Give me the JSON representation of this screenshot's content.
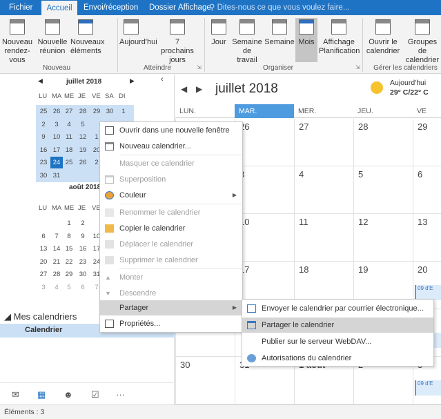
{
  "ribbon_tabs": [
    "Fichier",
    "Accueil",
    "Envoi/réception",
    "Dossier",
    "Affichage"
  ],
  "tell_me": "Dites-nous ce que vous voulez faire...",
  "ribbon": {
    "new_appointment": "Nouveau rendez-vous",
    "new_meeting": "Nouvelle réunion",
    "new_items": "Nouveaux éléments",
    "today": "Aujourd'hui",
    "next7": "7 prochains jours",
    "day": "Jour",
    "work_week": "Semaine de travail",
    "week": "Semaine",
    "month": "Mois",
    "schedule_view": "Affichage Planification",
    "open_calendar": "Ouvrir le calendrier",
    "calendar_groups": "Groupes de calendrier",
    "groups": [
      "Nouveau",
      "Atteindre",
      "Organiser",
      "Gérer les calendriers"
    ]
  },
  "nav": {
    "days_of_week": [
      "LU",
      "MA",
      "ME",
      "JE",
      "VE",
      "SA",
      "DI"
    ],
    "months": [
      {
        "title": "juillet 2018",
        "weeks": [
          [
            "25",
            "26",
            "27",
            "28",
            "29",
            "30",
            "1"
          ],
          [
            "2",
            "3",
            "4",
            "5",
            "",
            "",
            ""
          ],
          [
            "9",
            "10",
            "11",
            "12",
            "1",
            "",
            ""
          ],
          [
            "16",
            "17",
            "18",
            "19",
            "20",
            "",
            ""
          ],
          [
            "23",
            "24",
            "25",
            "26",
            "2",
            "",
            ""
          ],
          [
            "30",
            "31",
            "",
            "",
            "",
            "",
            ""
          ]
        ]
      },
      {
        "title": "août 2018",
        "weeks": [
          [
            "",
            "",
            "1",
            "2",
            "",
            "",
            ""
          ],
          [
            "6",
            "7",
            "8",
            "9",
            "10",
            "",
            ""
          ],
          [
            "13",
            "14",
            "15",
            "16",
            "17",
            "",
            ""
          ],
          [
            "20",
            "21",
            "22",
            "23",
            "24",
            "",
            ""
          ],
          [
            "27",
            "28",
            "29",
            "30",
            "31",
            "",
            ""
          ],
          [
            "3",
            "4",
            "5",
            "6",
            "7",
            "",
            ""
          ]
        ]
      }
    ],
    "my_calendars": "Mes calendriers",
    "calendar_item": "Calendrier"
  },
  "main": {
    "title": "juillet 2018",
    "weather_today": "Aujourd'hui",
    "weather_temp": "29° C/22° C",
    "columns": [
      "LUN.",
      "MAR.",
      "MER.",
      "JEU.",
      "VE"
    ],
    "rows": [
      [
        "",
        "26",
        "27",
        "28",
        "29"
      ],
      [
        "",
        "3",
        "4",
        "5",
        "6"
      ],
      [
        "",
        "10",
        "11",
        "12",
        "13"
      ],
      [
        "",
        "17",
        "18",
        "19",
        "20"
      ],
      [
        "",
        "",
        "",
        "",
        "7"
      ],
      [
        "30",
        "31",
        "1 août",
        "2",
        "3"
      ]
    ],
    "event_text": "09 d'E"
  },
  "context_menu": [
    {
      "label": "Ouvrir dans une nouvelle fenêtre",
      "disabled": false
    },
    {
      "label": "Nouveau calendrier...",
      "disabled": false
    },
    {
      "label": "Masquer ce calendrier",
      "disabled": true
    },
    {
      "label": "Superposition",
      "disabled": true
    },
    {
      "label": "Couleur",
      "disabled": false
    },
    {
      "label": "Renommer le calendrier",
      "disabled": true
    },
    {
      "label": "Copier le calendrier",
      "disabled": false
    },
    {
      "label": "Déplacer le calendrier",
      "disabled": true
    },
    {
      "label": "Supprimer le calendrier",
      "disabled": true
    },
    {
      "label": "Monter",
      "disabled": true
    },
    {
      "label": "Descendre",
      "disabled": true
    },
    {
      "label": "Partager",
      "disabled": false
    },
    {
      "label": "Propriétés...",
      "disabled": false
    }
  ],
  "submenu": [
    "Envoyer le calendrier par courrier électronique...",
    "Partager le calendrier",
    "Publier sur le serveur WebDAV...",
    "Autorisations du calendrier"
  ],
  "status": "Éléments : 3",
  "colors": {
    "accent": "#1e73c4",
    "today": "#4f9be0",
    "selection": "#cce0f5",
    "menu_highlight": "#d5d5d5"
  }
}
